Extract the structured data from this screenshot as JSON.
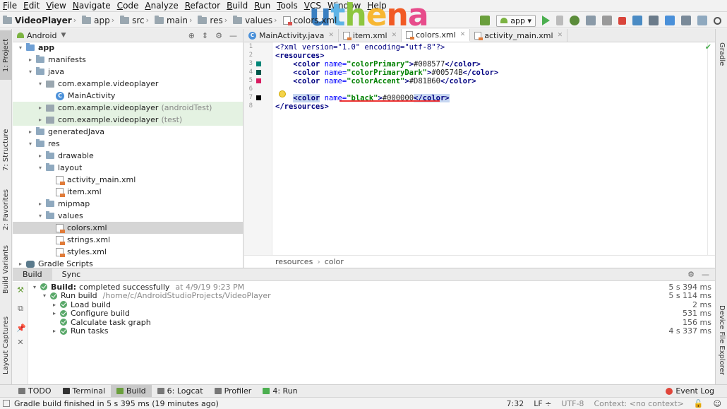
{
  "menu": [
    "File",
    "Edit",
    "View",
    "Navigate",
    "Code",
    "Analyze",
    "Refactor",
    "Build",
    "Run",
    "Tools",
    "VCS",
    "Window",
    "Help"
  ],
  "logo": {
    "text": "uthena",
    "colors": [
      "#3a7fc1",
      "#5fb4e6",
      "#8dc63f",
      "#f7b733",
      "#f15a24",
      "#e74c8b"
    ]
  },
  "breadcrumb": [
    "VideoPlayer",
    "app",
    "src",
    "main",
    "res",
    "values",
    "colors.xml"
  ],
  "run_config": "app",
  "left_strip": {
    "project": "1: Project",
    "structure": "7: Structure",
    "favorites": "2: Favorites",
    "build_variants": "Build Variants",
    "layout_captures": "Layout Captures"
  },
  "right_strip": {
    "gradle": "Gradle",
    "device_explorer": "Device File Explorer"
  },
  "project_panel": {
    "view_mode": "Android",
    "tree": [
      {
        "label": "app",
        "indent": 0,
        "arrow": "▾",
        "icon": "folder-blue"
      },
      {
        "label": "manifests",
        "indent": 1,
        "arrow": "▸",
        "icon": "folder"
      },
      {
        "label": "java",
        "indent": 1,
        "arrow": "▾",
        "icon": "folder"
      },
      {
        "label": "com.example.videoplayer",
        "indent": 2,
        "arrow": "▾",
        "icon": "package"
      },
      {
        "label": "MainActivity",
        "indent": 3,
        "arrow": "",
        "icon": "class"
      },
      {
        "label": "com.example.videoplayer",
        "suffix": "(androidTest)",
        "indent": 2,
        "arrow": "▸",
        "icon": "package",
        "hl": true
      },
      {
        "label": "com.example.videoplayer",
        "suffix": "(test)",
        "indent": 2,
        "arrow": "▸",
        "icon": "package",
        "hl": true
      },
      {
        "label": "generatedJava",
        "indent": 1,
        "arrow": "▸",
        "icon": "folder"
      },
      {
        "label": "res",
        "indent": 1,
        "arrow": "▾",
        "icon": "folder"
      },
      {
        "label": "drawable",
        "indent": 2,
        "arrow": "▸",
        "icon": "folder"
      },
      {
        "label": "layout",
        "indent": 2,
        "arrow": "▾",
        "icon": "folder"
      },
      {
        "label": "activity_main.xml",
        "indent": 3,
        "arrow": "",
        "icon": "xml"
      },
      {
        "label": "item.xml",
        "indent": 3,
        "arrow": "",
        "icon": "xml"
      },
      {
        "label": "mipmap",
        "indent": 2,
        "arrow": "▸",
        "icon": "folder"
      },
      {
        "label": "values",
        "indent": 2,
        "arrow": "▾",
        "icon": "folder"
      },
      {
        "label": "colors.xml",
        "indent": 3,
        "arrow": "",
        "icon": "xml",
        "sel": true
      },
      {
        "label": "strings.xml",
        "indent": 3,
        "arrow": "",
        "icon": "xml"
      },
      {
        "label": "styles.xml",
        "indent": 3,
        "arrow": "",
        "icon": "xml"
      },
      {
        "label": "Gradle Scripts",
        "indent": 0,
        "arrow": "▸",
        "icon": "gradle"
      }
    ]
  },
  "editor_tabs": [
    {
      "label": "MainActivity.java",
      "icon": "class"
    },
    {
      "label": "item.xml",
      "icon": "xml"
    },
    {
      "label": "colors.xml",
      "icon": "xml",
      "active": true
    },
    {
      "label": "activity_main.xml",
      "icon": "xml"
    }
  ],
  "code": {
    "line_numbers": [
      "1",
      "2",
      "3",
      "4",
      "5",
      "6",
      "7",
      "8"
    ],
    "line1": "<?xml version=\"1.0\" encoding=\"utf-8\"?>",
    "line2": "<resources>",
    "line3": {
      "name": "colorPrimary",
      "value": "#008577"
    },
    "line4": {
      "name": "colorPrimaryDark",
      "value": "#00574B"
    },
    "line5": {
      "name": "colorAccent",
      "value": "#D81B60"
    },
    "line7": {
      "name": "black",
      "value": "#000000"
    },
    "line8": "</resources>",
    "swatches": {
      "line3": "#008577",
      "line4": "#00574B",
      "line5": "#D81B60",
      "line7": "#000000"
    }
  },
  "editor_breadcrumb": [
    "resources",
    "color"
  ],
  "build_panel": {
    "tabs": [
      "Build",
      "Sync"
    ],
    "rows": [
      {
        "bold": "Build:",
        "text": "completed successfully",
        "muted": "at 4/9/19 9:23 PM",
        "time": "5 s 394 ms",
        "indent": 0,
        "arrow": "▾"
      },
      {
        "text": "Run build",
        "muted": "/home/c/AndroidStudioProjects/VideoPlayer",
        "time": "5 s 114 ms",
        "indent": 1,
        "arrow": "▾"
      },
      {
        "text": "Load build",
        "time": "2 ms",
        "indent": 2,
        "arrow": "▸"
      },
      {
        "text": "Configure build",
        "time": "531 ms",
        "indent": 2,
        "arrow": "▸"
      },
      {
        "text": "Calculate task graph",
        "time": "156 ms",
        "indent": 2,
        "arrow": ""
      },
      {
        "text": "Run tasks",
        "time": "4 s 337 ms",
        "indent": 2,
        "arrow": "▸"
      }
    ]
  },
  "bottom_tabs": [
    "TODO",
    "Terminal",
    "Build",
    "6: Logcat",
    "Profiler",
    "4: Run"
  ],
  "event_log": "Event Log",
  "status": {
    "message": "Gradle build finished in 5 s 395 ms (19 minutes ago)",
    "position": "7:32",
    "line_sep": "LF ÷",
    "encoding": "UTF-8",
    "context": "Context: <no context>"
  }
}
